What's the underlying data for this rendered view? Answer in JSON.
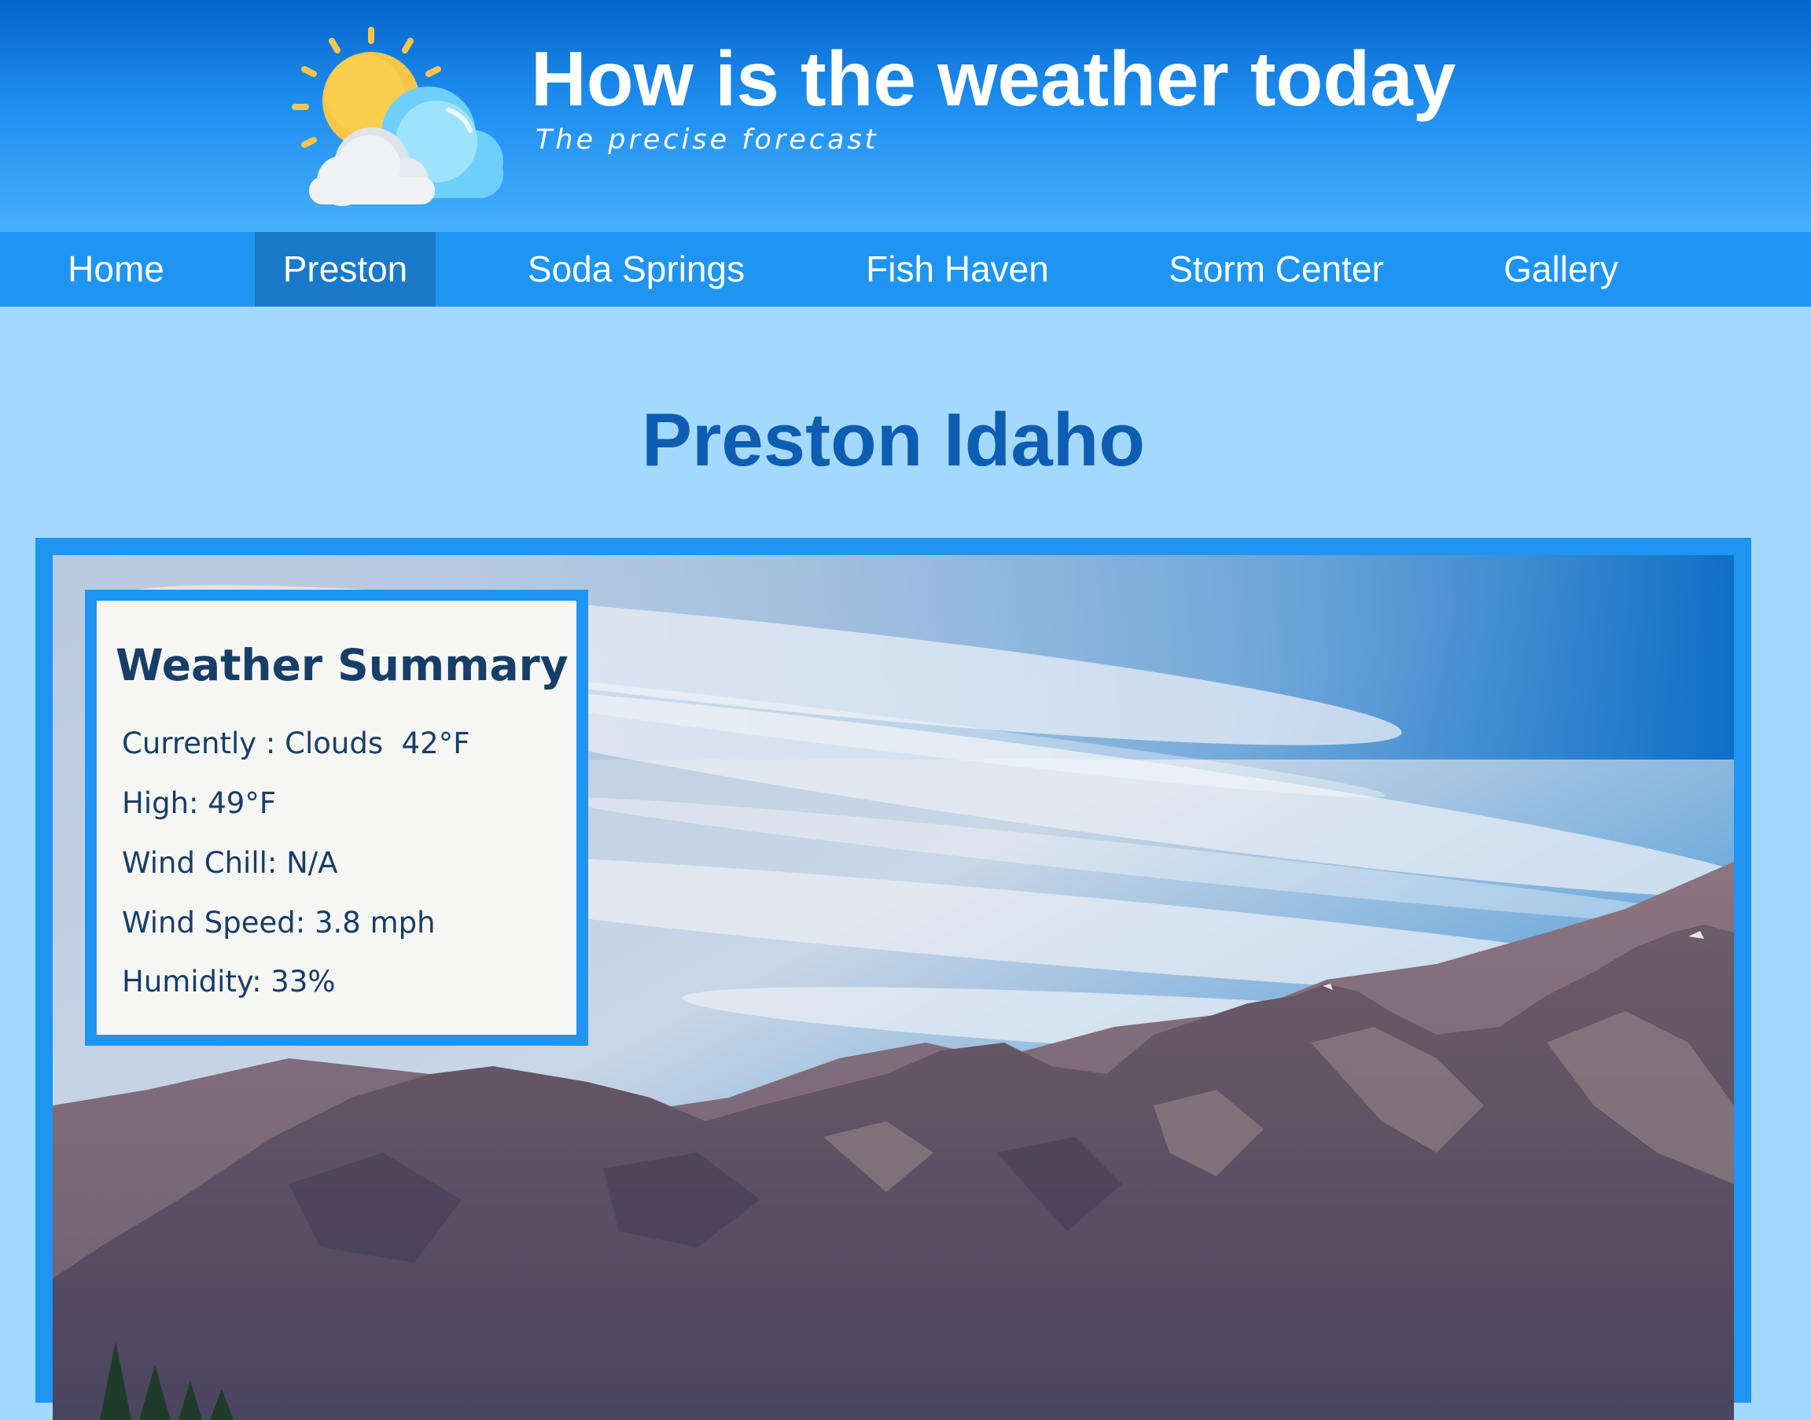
{
  "header": {
    "title": "How is the weather today",
    "tagline": "The precise forecast",
    "logo_icon": "partly-cloudy-sun-icon"
  },
  "nav": {
    "items": [
      {
        "label": "Home",
        "active": false
      },
      {
        "label": "Preston",
        "active": true
      },
      {
        "label": "Soda Springs",
        "active": false
      },
      {
        "label": "Fish Haven",
        "active": false
      },
      {
        "label": "Storm Center",
        "active": false
      },
      {
        "label": "Gallery",
        "active": false
      }
    ]
  },
  "page": {
    "title": "Preston Idaho"
  },
  "summary": {
    "title": "Weather Summary",
    "currently": "Currently : Clouds  42°F",
    "high": "High: 49°F",
    "wind_chill": "Wind Chill: N/A",
    "wind_speed": "Wind Speed: 3.8 mph",
    "humidity": "Humidity: 33%"
  },
  "colors": {
    "header_dark": "#0565c9",
    "header_light": "#45b0fb",
    "nav_bg": "#1e95f3",
    "nav_active": "#1a79c9",
    "page_bg": "#a3d9ff",
    "title_color": "#0d5db3",
    "summary_text": "#173e69"
  }
}
